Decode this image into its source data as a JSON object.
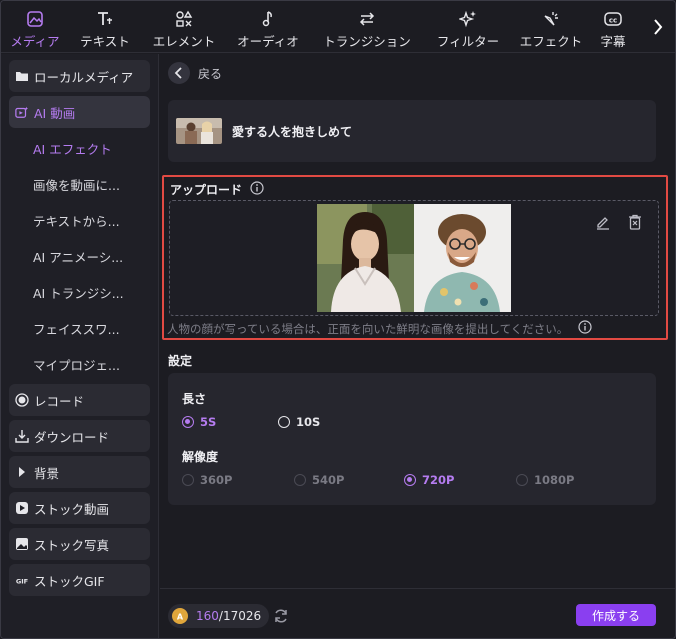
{
  "toolbar": {
    "tabs": [
      {
        "label": "メディア",
        "icon": "media-icon",
        "active": true
      },
      {
        "label": "テキスト",
        "icon": "text-icon"
      },
      {
        "label": "エレメント",
        "icon": "elements-icon"
      },
      {
        "label": "オーディオ",
        "icon": "audio-icon"
      },
      {
        "label": "トランジション",
        "icon": "transition-icon"
      },
      {
        "label": "フィルター",
        "icon": "filter-icon"
      },
      {
        "label": "エフェクト",
        "icon": "effect-icon"
      },
      {
        "label": "字幕",
        "icon": "captions-icon"
      }
    ]
  },
  "sidebar": {
    "items": [
      {
        "label": "ローカルメディア",
        "icon": "folder-icon"
      },
      {
        "label": "AI 動画",
        "icon": "ai-video-icon",
        "active": true
      },
      {
        "label": "AI エフェクト",
        "sub": true,
        "active": true
      },
      {
        "label": "画像を動画に...",
        "sub": true
      },
      {
        "label": "テキストから...",
        "sub": true
      },
      {
        "label": "AI アニメーシ...",
        "sub": true
      },
      {
        "label": "AI トランジシ...",
        "sub": true
      },
      {
        "label": "フェイススワ...",
        "sub": true
      },
      {
        "label": "マイプロジェ...",
        "sub": true
      },
      {
        "label": "レコード",
        "icon": "record-icon"
      },
      {
        "label": "ダウンロード",
        "icon": "download-icon"
      },
      {
        "label": "背景",
        "icon": "triangle-icon"
      },
      {
        "label": "ストック動画",
        "icon": "play-icon"
      },
      {
        "label": "ストック写真",
        "icon": "image-icon"
      },
      {
        "label": "ストックGIF",
        "icon": "gif-icon"
      }
    ]
  },
  "main": {
    "back_label": "戻る",
    "effect_title": "愛する人を抱きしめて",
    "upload": {
      "title": "アップロード",
      "hint": "人物の顔が写っている場合は、正面を向いた鮮明な画像を提出してください。"
    },
    "settings": {
      "title": "設定",
      "duration_label": "長さ",
      "duration_options": [
        "5S",
        "10S"
      ],
      "duration_selected": "5S",
      "resolution_label": "解像度",
      "resolution_options": [
        "360P",
        "540P",
        "720P",
        "1080P"
      ],
      "resolution_selected": "720P"
    },
    "footer": {
      "credits_used": "160",
      "credits_total": "/17026",
      "create_label": "作成する"
    }
  },
  "colors": {
    "accent": "#b57cf0",
    "button": "#8a3ff0",
    "highlight_border": "#e24a43",
    "background": "#1c1c22"
  }
}
